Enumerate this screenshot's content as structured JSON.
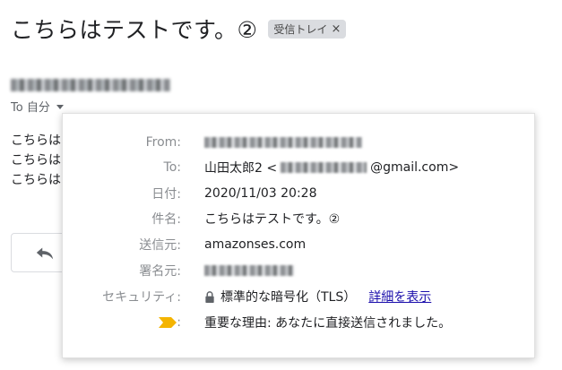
{
  "subject": "こちらはテストです。②",
  "label_chip": {
    "text": "受信トレイ",
    "close": "×"
  },
  "to_line": {
    "text": "To 自分"
  },
  "body_lines": [
    "こちらは",
    "こちらは",
    "こちらは"
  ],
  "details": {
    "rows": [
      {
        "label": "From:",
        "value": ""
      },
      {
        "label": "To:",
        "value_prefix": "山田太郎2 <",
        "value_suffix": "@gmail.com>"
      },
      {
        "label": "日付:",
        "value": "2020/11/03 20:28"
      },
      {
        "label": "件名:",
        "value": "こちらはテストです。②"
      },
      {
        "label": "送信元:",
        "value": "amazonses.com"
      },
      {
        "label": "署名元:",
        "value": ""
      },
      {
        "label": "セキュリティ:",
        "value": "標準的な暗号化（TLS）",
        "link": "詳細を表示"
      },
      {
        "label": ":",
        "value": "重要な理由: あなたに直接送信されました。"
      }
    ]
  },
  "colors": {
    "importance_marker": "#f4b400",
    "link": "#1a0dab"
  },
  "icons": {
    "lock": "lock-icon",
    "importance": "importance-marker-icon",
    "reply": "reply-arrow-icon",
    "dropdown": "chevron-down-icon"
  }
}
